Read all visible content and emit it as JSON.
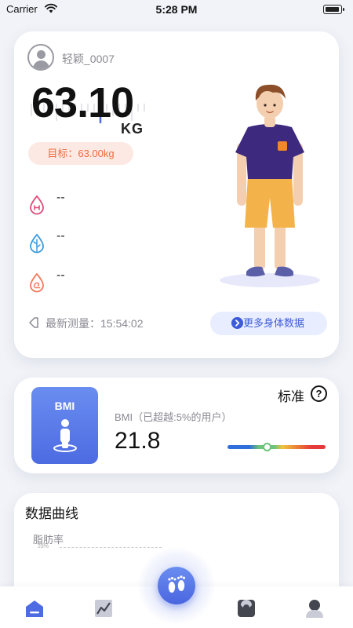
{
  "status_bar": {
    "carrier": "Carrier",
    "time": "5:28 PM"
  },
  "profile": {
    "username": "轻颖_0007"
  },
  "weight": {
    "value": "63.10",
    "unit": "KG",
    "goal": "目标：63.00kg"
  },
  "metrics": [
    {
      "icon": "fat-drop-icon",
      "value": "--",
      "color": "#e54a7a"
    },
    {
      "icon": "water-leaf-icon",
      "value": "--",
      "color": "#3b9be0"
    },
    {
      "icon": "muscle-drop-icon",
      "value": "--",
      "color": "#f07a5a"
    }
  ],
  "last_measure": {
    "text": "最新测量：15:54:02"
  },
  "more_button": {
    "label": "更多身体数据"
  },
  "bmi": {
    "tile_label": "BMI",
    "caption": "BMI（已超越:5%的用户）",
    "value": "21.8",
    "status": "标准",
    "help": "?",
    "level_fraction": 0.4
  },
  "curve": {
    "title": "数据曲线",
    "series_label": "脂肪率",
    "tick": "29%"
  },
  "colors": {
    "accent": "#4d6be2",
    "goal_text": "#ef6a3e",
    "goal_bg": "#fde9e3"
  },
  "tabs": [
    {
      "icon": "home-icon",
      "active": true
    },
    {
      "icon": "chart-icon",
      "active": false
    },
    {
      "icon": "footprint-icon",
      "active": false
    },
    {
      "icon": "scale-icon",
      "active": false
    },
    {
      "icon": "profile-icon",
      "active": false
    }
  ]
}
